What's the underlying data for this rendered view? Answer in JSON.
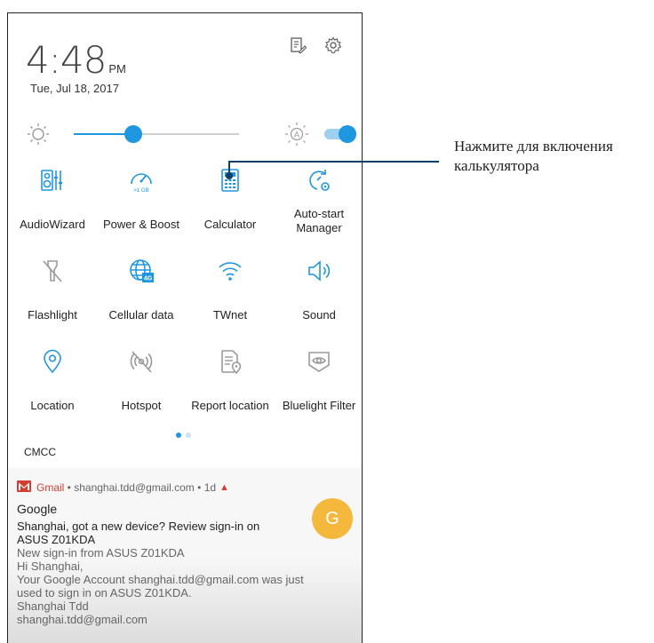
{
  "status": {
    "time": "4:48",
    "ampm": "PM",
    "date": "Tue, Jul 18, 2017"
  },
  "brightness": {
    "level_percent": 36,
    "auto": true
  },
  "tiles": [
    {
      "label": "AudioWizard",
      "icon": "audio-wizard-icon",
      "active": true
    },
    {
      "label": "Power & Boost",
      "icon": "power-boost-icon",
      "active": true,
      "badge": ">1 GB"
    },
    {
      "label": "Calculator",
      "icon": "calculator-icon",
      "active": true
    },
    {
      "label": "Auto-start\nManager",
      "icon": "auto-start-icon",
      "active": true
    },
    {
      "label": "Flashlight",
      "icon": "flashlight-icon",
      "active": false
    },
    {
      "label": "Cellular data",
      "icon": "cellular-data-icon",
      "active": true,
      "badge": "4G"
    },
    {
      "label": "TWnet",
      "icon": "wifi-icon",
      "active": true
    },
    {
      "label": "Sound",
      "icon": "sound-icon",
      "active": true
    },
    {
      "label": "Location",
      "icon": "location-icon",
      "active": true
    },
    {
      "label": "Hotspot",
      "icon": "hotspot-icon",
      "active": false
    },
    {
      "label": "Report location",
      "icon": "report-location-icon",
      "active": false
    },
    {
      "label": "Bluelight Filter",
      "icon": "bluelight-filter-icon",
      "active": false
    }
  ],
  "carrier": "CMCC",
  "notification": {
    "app": "Gmail",
    "account": "shanghai.tdd@gmail.com",
    "age": "1d",
    "title": "Google",
    "avatar_letter": "G",
    "lines": [
      "Shanghai, got a new device? Review sign-in on",
      "ASUS Z01KDA"
    ],
    "muted_lines": [
      "New sign-in from ASUS Z01KDA",
      "Hi Shanghai,",
      "Your Google Account shanghai.tdd@gmail.com was just",
      "used to sign in on ASUS Z01KDA.",
      "Shanghai Tdd",
      "shanghai.tdd@gmail.com"
    ]
  },
  "callout": "Нажмите для включения калькулятора",
  "colors": {
    "accent": "#1f97e0",
    "icon_active": "#1f97e0",
    "icon_inactive": "#9a9a9a",
    "gmail": "#d23f31",
    "avatar": "#f4b93c",
    "callout_line": "#0d3f6b"
  }
}
